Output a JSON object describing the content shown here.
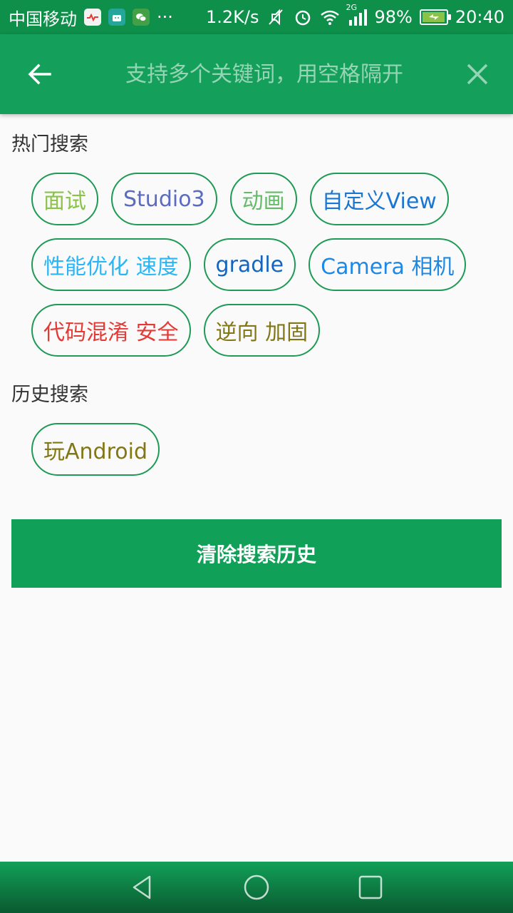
{
  "status_bar": {
    "carrier": "中国移动",
    "more": "···",
    "net_speed": "1.2K/s",
    "network_type": "2G",
    "battery": "98%",
    "battery_level": 0.98,
    "time": "20:40",
    "icons": [
      "heart-rate-app-icon",
      "android-app-icon",
      "wechat-app-icon",
      "mute-icon",
      "alarm-icon",
      "wifi-icon",
      "signal-icon",
      "battery-charging-icon"
    ]
  },
  "app_bar": {
    "back_icon": "arrow-left-icon",
    "search_placeholder": "支持多个关键词，用空格隔开",
    "search_value": "",
    "clear_icon": "close-icon"
  },
  "hot": {
    "title": "热门搜索",
    "tags": [
      {
        "label": "面试",
        "color": "#8bc34a"
      },
      {
        "label": "Studio3",
        "color": "#5c6bc0"
      },
      {
        "label": "动画",
        "color": "#66bb6a"
      },
      {
        "label": "自定义View",
        "color": "#1976d2"
      },
      {
        "label": "性能优化 速度",
        "color": "#29b6f6"
      },
      {
        "label": "gradle",
        "color": "#1565c0"
      },
      {
        "label": "Camera 相机",
        "color": "#1e88e5"
      },
      {
        "label": "代码混淆 安全",
        "color": "#e53935"
      },
      {
        "label": "逆向 加固",
        "color": "#827717"
      }
    ]
  },
  "history": {
    "title": "历史搜索",
    "tags": [
      {
        "label": "玩Android",
        "color": "#827717"
      }
    ]
  },
  "clear_history_label": "清除搜索历史",
  "colors": {
    "status_bar": "#0e8f4a",
    "app_bar": "#14a05a",
    "tag_border": "#1e9a55",
    "button": "#11a058"
  },
  "nav_bar": {
    "icons": [
      "back-triangle-icon",
      "home-circle-icon",
      "recents-square-icon"
    ]
  }
}
